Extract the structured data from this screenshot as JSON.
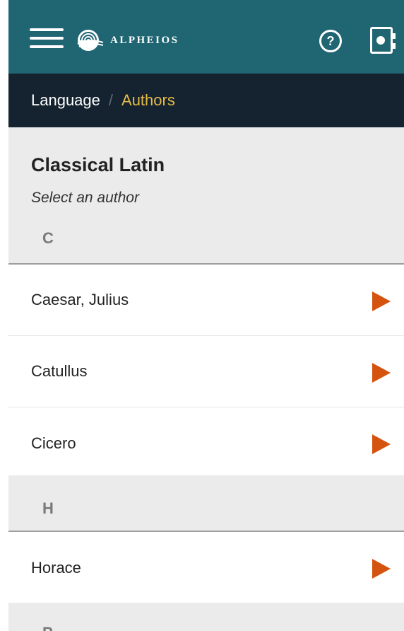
{
  "app": {
    "logo_text": "ALPHEIOS",
    "help_label": "?",
    "accent_color": "#1f6572",
    "breadcrumb_bg": "#14232f",
    "arrow_color": "#d4540f"
  },
  "breadcrumb": {
    "parent": "Language",
    "separator": "/",
    "current": "Authors"
  },
  "page": {
    "title": "Classical Latin",
    "subtitle": "Select an author"
  },
  "sections": [
    {
      "letter": "C",
      "authors": [
        "Caesar, Julius",
        "Catullus",
        "Cicero"
      ]
    },
    {
      "letter": "H",
      "authors": [
        "Horace"
      ]
    },
    {
      "letter": "P",
      "authors": []
    }
  ],
  "icons": {
    "menu": "hamburger-icon",
    "help": "help-circle-icon",
    "account": "book-icon",
    "row_arrow": "play-arrow-icon"
  }
}
